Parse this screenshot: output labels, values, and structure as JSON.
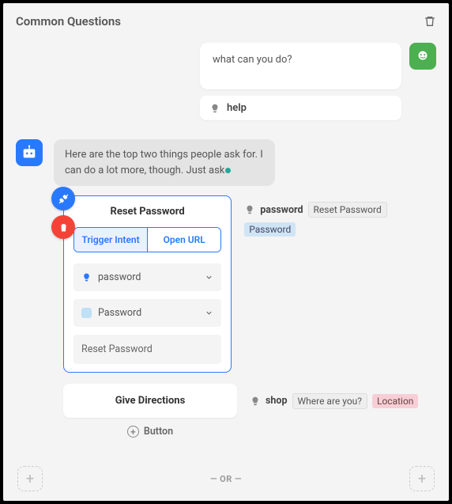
{
  "header": {
    "title": "Common Questions"
  },
  "user_message": {
    "text": "what can you do?"
  },
  "intent_pill": {
    "label": "help"
  },
  "bot_message": {
    "text": "Here are the top two things people ask for. I can do a lot more, though. Just ask"
  },
  "card": {
    "title": "Reset Password",
    "tabs": {
      "trigger": "Trigger Intent",
      "open_url": "Open URL"
    },
    "field1": {
      "label": "password"
    },
    "field2": {
      "label": "Password"
    },
    "field3": {
      "label": "Reset Password"
    }
  },
  "card_meta": {
    "label": "password",
    "tag1": "Reset Password",
    "tag2": "Password"
  },
  "secondary": {
    "title": "Give Directions"
  },
  "secondary_meta": {
    "label": "shop",
    "tag1": "Where are you?",
    "tag2": "Location"
  },
  "add_button": {
    "label": "Button"
  },
  "footer": {
    "or": "— OR —"
  }
}
